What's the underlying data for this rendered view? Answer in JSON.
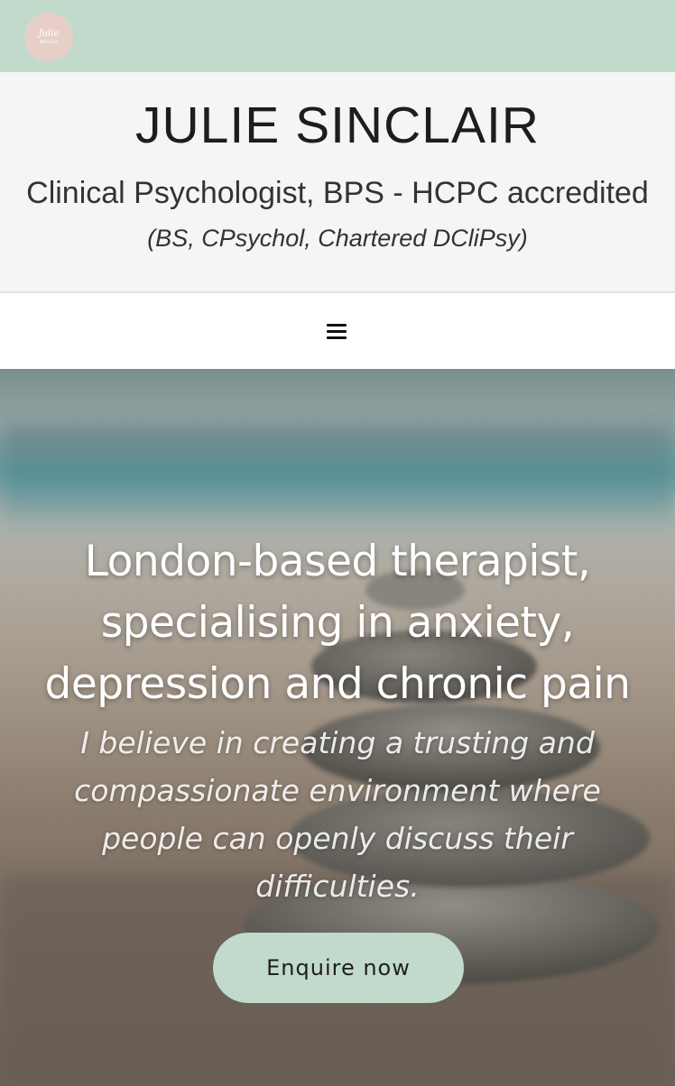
{
  "logo": {
    "name": "Julie",
    "sub": "Sinclair"
  },
  "header": {
    "title": "JULIE SINCLAIR",
    "subtitle": "Clinical Psychologist, BPS - HCPC accredited",
    "credentials": "(BS, CPsychol, Chartered DCliPsy)"
  },
  "nav": {
    "menu_icon": "hamburger-menu-icon"
  },
  "hero": {
    "heading": "London-based therapist, specialising in anxiety, depression and chronic pain",
    "text": "I believe in creating a trusting and compassionate environment where people can openly discuss their difficulties.",
    "cta_label": "Enquire now"
  },
  "colors": {
    "brand_green": "#c2dacb",
    "logo_pink": "#e7cfc8",
    "header_bg": "#f5f5f5"
  }
}
